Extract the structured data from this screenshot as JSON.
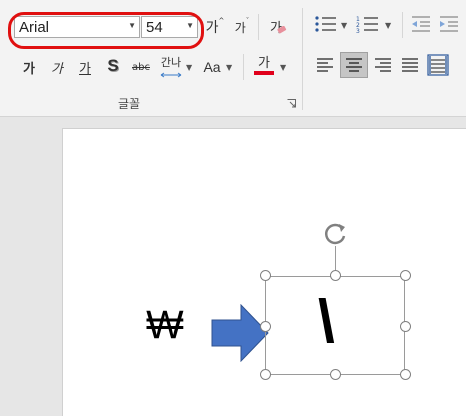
{
  "font_group": {
    "font_name": "Arial",
    "font_size": "54",
    "group_label": "글꼴",
    "grow_font_glyph": "가",
    "shrink_font_glyph": "가",
    "clear_format_glyph": "가",
    "bold_glyph": "가",
    "italic_glyph": "가",
    "underline_glyph": "가",
    "shadow_glyph": "S",
    "strike_glyph": "abc",
    "spacing_glyph": "간나",
    "case_glyph": "Aa",
    "font_color_glyph": "가",
    "font_color": "#e0001b"
  },
  "slide": {
    "won_symbol": "₩",
    "textbox_text": "\\"
  },
  "colors": {
    "highlight_ring": "#e01010",
    "arrow_fill": "#4472c4",
    "arrow_stroke": "#2f528f"
  }
}
